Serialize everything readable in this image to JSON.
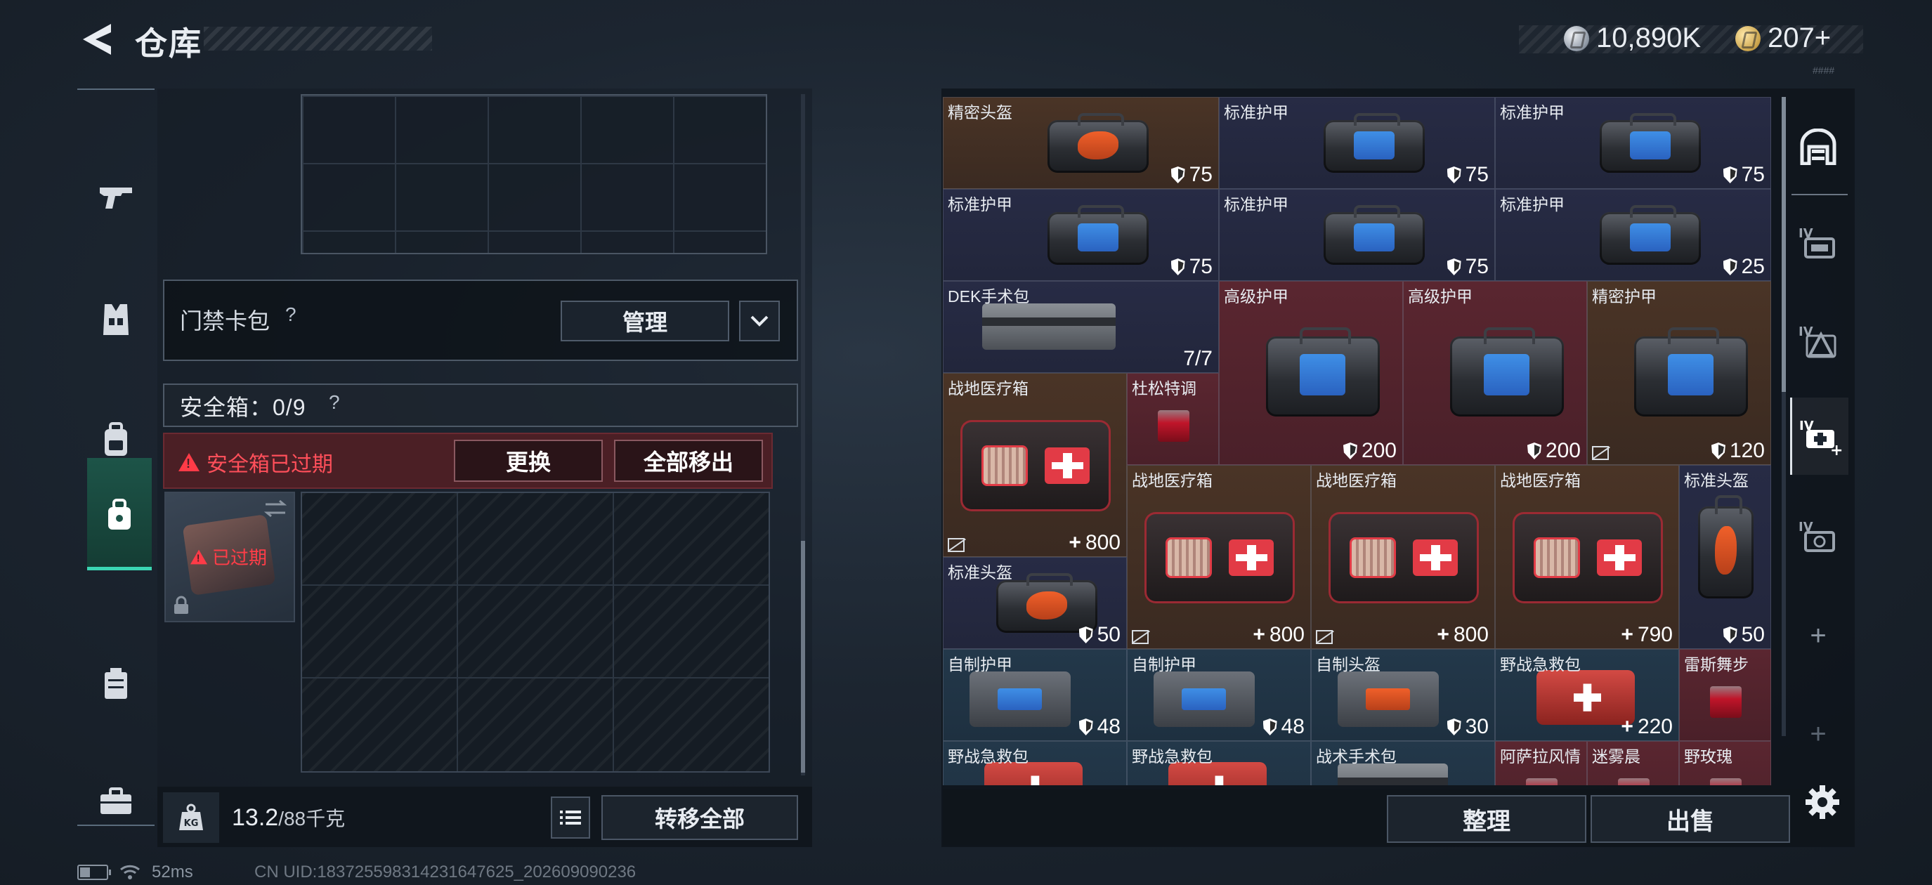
{
  "header": {
    "title": "仓库",
    "currencies": [
      {
        "icon": "silver-coin-icon",
        "value": "10,890K"
      },
      {
        "icon": "gold-coin-icon",
        "value": "207+"
      }
    ],
    "small_tag": "####"
  },
  "left_nav": {
    "items": [
      "gun-icon",
      "vest-icon",
      "backpack-icon",
      "safebox-icon",
      "rig-icon",
      "briefcase-icon"
    ],
    "active": "safebox-icon"
  },
  "keycard": {
    "label": "门禁卡包",
    "help": "?",
    "manage_label": "管理"
  },
  "safebox": {
    "label": "安全箱：0/9",
    "help": "?",
    "expired_warning": "安全箱已过期",
    "replace_label": "更换",
    "move_all_label": "全部移出",
    "item_label": "已过期"
  },
  "weight": {
    "current": "13.2",
    "max": "/88千克",
    "transfer_all_label": "转移全部"
  },
  "status": {
    "ping": "52ms",
    "uid": "CN UID:1837255983142316476​25_202609090236"
  },
  "storage": {
    "items": [
      {
        "name": "精密头盔",
        "value": "75",
        "badge": "shield",
        "color": "brown",
        "art": "bag-orange"
      },
      {
        "name": "标准护甲",
        "value": "75",
        "badge": "shield",
        "color": "navy",
        "art": "bag-blue"
      },
      {
        "name": "标准护甲",
        "value": "75",
        "badge": "shield",
        "color": "navy",
        "art": "bag-blue"
      },
      {
        "name": "标准护甲",
        "value": "75",
        "badge": "shield",
        "color": "navy",
        "art": "bag-blue"
      },
      {
        "name": "标准护甲",
        "value": "75",
        "badge": "shield",
        "color": "navy",
        "art": "bag-blue"
      },
      {
        "name": "标准护甲",
        "value": "25",
        "badge": "shield",
        "color": "navy",
        "art": "bag-blue"
      },
      {
        "name": "DEK手术包",
        "value": "7/7",
        "badge": "none",
        "color": "navy",
        "art": "pouch"
      },
      {
        "name": "高级护甲",
        "value": "200",
        "badge": "shield",
        "color": "red",
        "art": "bag-blue"
      },
      {
        "name": "高级护甲",
        "value": "200",
        "badge": "shield",
        "color": "red",
        "art": "bag-blue"
      },
      {
        "name": "精密护甲",
        "value": "120",
        "badge": "shield",
        "color": "brown",
        "art": "bag-blue"
      },
      {
        "name": "战地医疗箱",
        "value": "800",
        "badge": "plus",
        "color": "brown",
        "art": "medkit"
      },
      {
        "name": "杜松特调",
        "value": "",
        "badge": "none",
        "color": "red",
        "art": "glass"
      },
      {
        "name": "战地医疗箱",
        "value": "800",
        "badge": "plus",
        "color": "brown",
        "art": "medkit"
      },
      {
        "name": "战地医疗箱",
        "value": "800",
        "badge": "plus",
        "color": "brown",
        "art": "medkit"
      },
      {
        "name": "战地医疗箱",
        "value": "790",
        "badge": "plus",
        "color": "brown",
        "art": "medkit"
      },
      {
        "name": "标准头盔",
        "value": "50",
        "badge": "shield",
        "color": "navy",
        "art": "helmet"
      },
      {
        "name": "标准头盔",
        "value": "50",
        "badge": "shield",
        "color": "navy",
        "art": "bag-orange"
      },
      {
        "name": "自制护甲",
        "value": "48",
        "badge": "shield",
        "color": "teal",
        "art": "vest-blue"
      },
      {
        "name": "自制护甲",
        "value": "48",
        "badge": "shield",
        "color": "teal",
        "art": "vest-blue"
      },
      {
        "name": "自制头盔",
        "value": "30",
        "badge": "shield",
        "color": "teal",
        "art": "vest-orange"
      },
      {
        "name": "野战急救包",
        "value": "220",
        "badge": "plus",
        "color": "teal",
        "art": "kit-red"
      },
      {
        "name": "雷斯舞步",
        "value": "",
        "badge": "none",
        "color": "red",
        "art": "glass"
      },
      {
        "name": "野战急救包",
        "value": "",
        "badge": "none",
        "color": "teal",
        "art": "kit-red"
      },
      {
        "name": "野战急救包",
        "value": "",
        "badge": "none",
        "color": "teal",
        "art": "kit-red"
      },
      {
        "name": "战术手术包",
        "value": "",
        "badge": "none",
        "color": "teal",
        "art": "pouch"
      },
      {
        "name": "阿萨拉风情",
        "value": "",
        "badge": "none",
        "color": "red",
        "art": "glass"
      },
      {
        "name": "迷雾晨",
        "value": "",
        "badge": "none",
        "color": "red",
        "art": "glass"
      },
      {
        "name": "野玫瑰",
        "value": "",
        "badge": "none",
        "color": "red",
        "art": "glass"
      }
    ],
    "sort_label": "整理",
    "sell_label": "出售"
  },
  "side_tabs": [
    "storage-home-icon",
    "storage-tab-iv-1-icon",
    "storage-tab-iv-2-icon",
    "storage-tab-iv-add-icon",
    "storage-tab-iv-3-icon",
    "add-tab-icon",
    "add-tab-icon"
  ],
  "colors": {
    "accent_teal": "#3bd6b3",
    "warning_red": "#ff3b47",
    "cell_brown": "#4a3426",
    "cell_navy": "#272b45",
    "cell_red": "#5a2630",
    "cell_teal": "#23384a"
  }
}
